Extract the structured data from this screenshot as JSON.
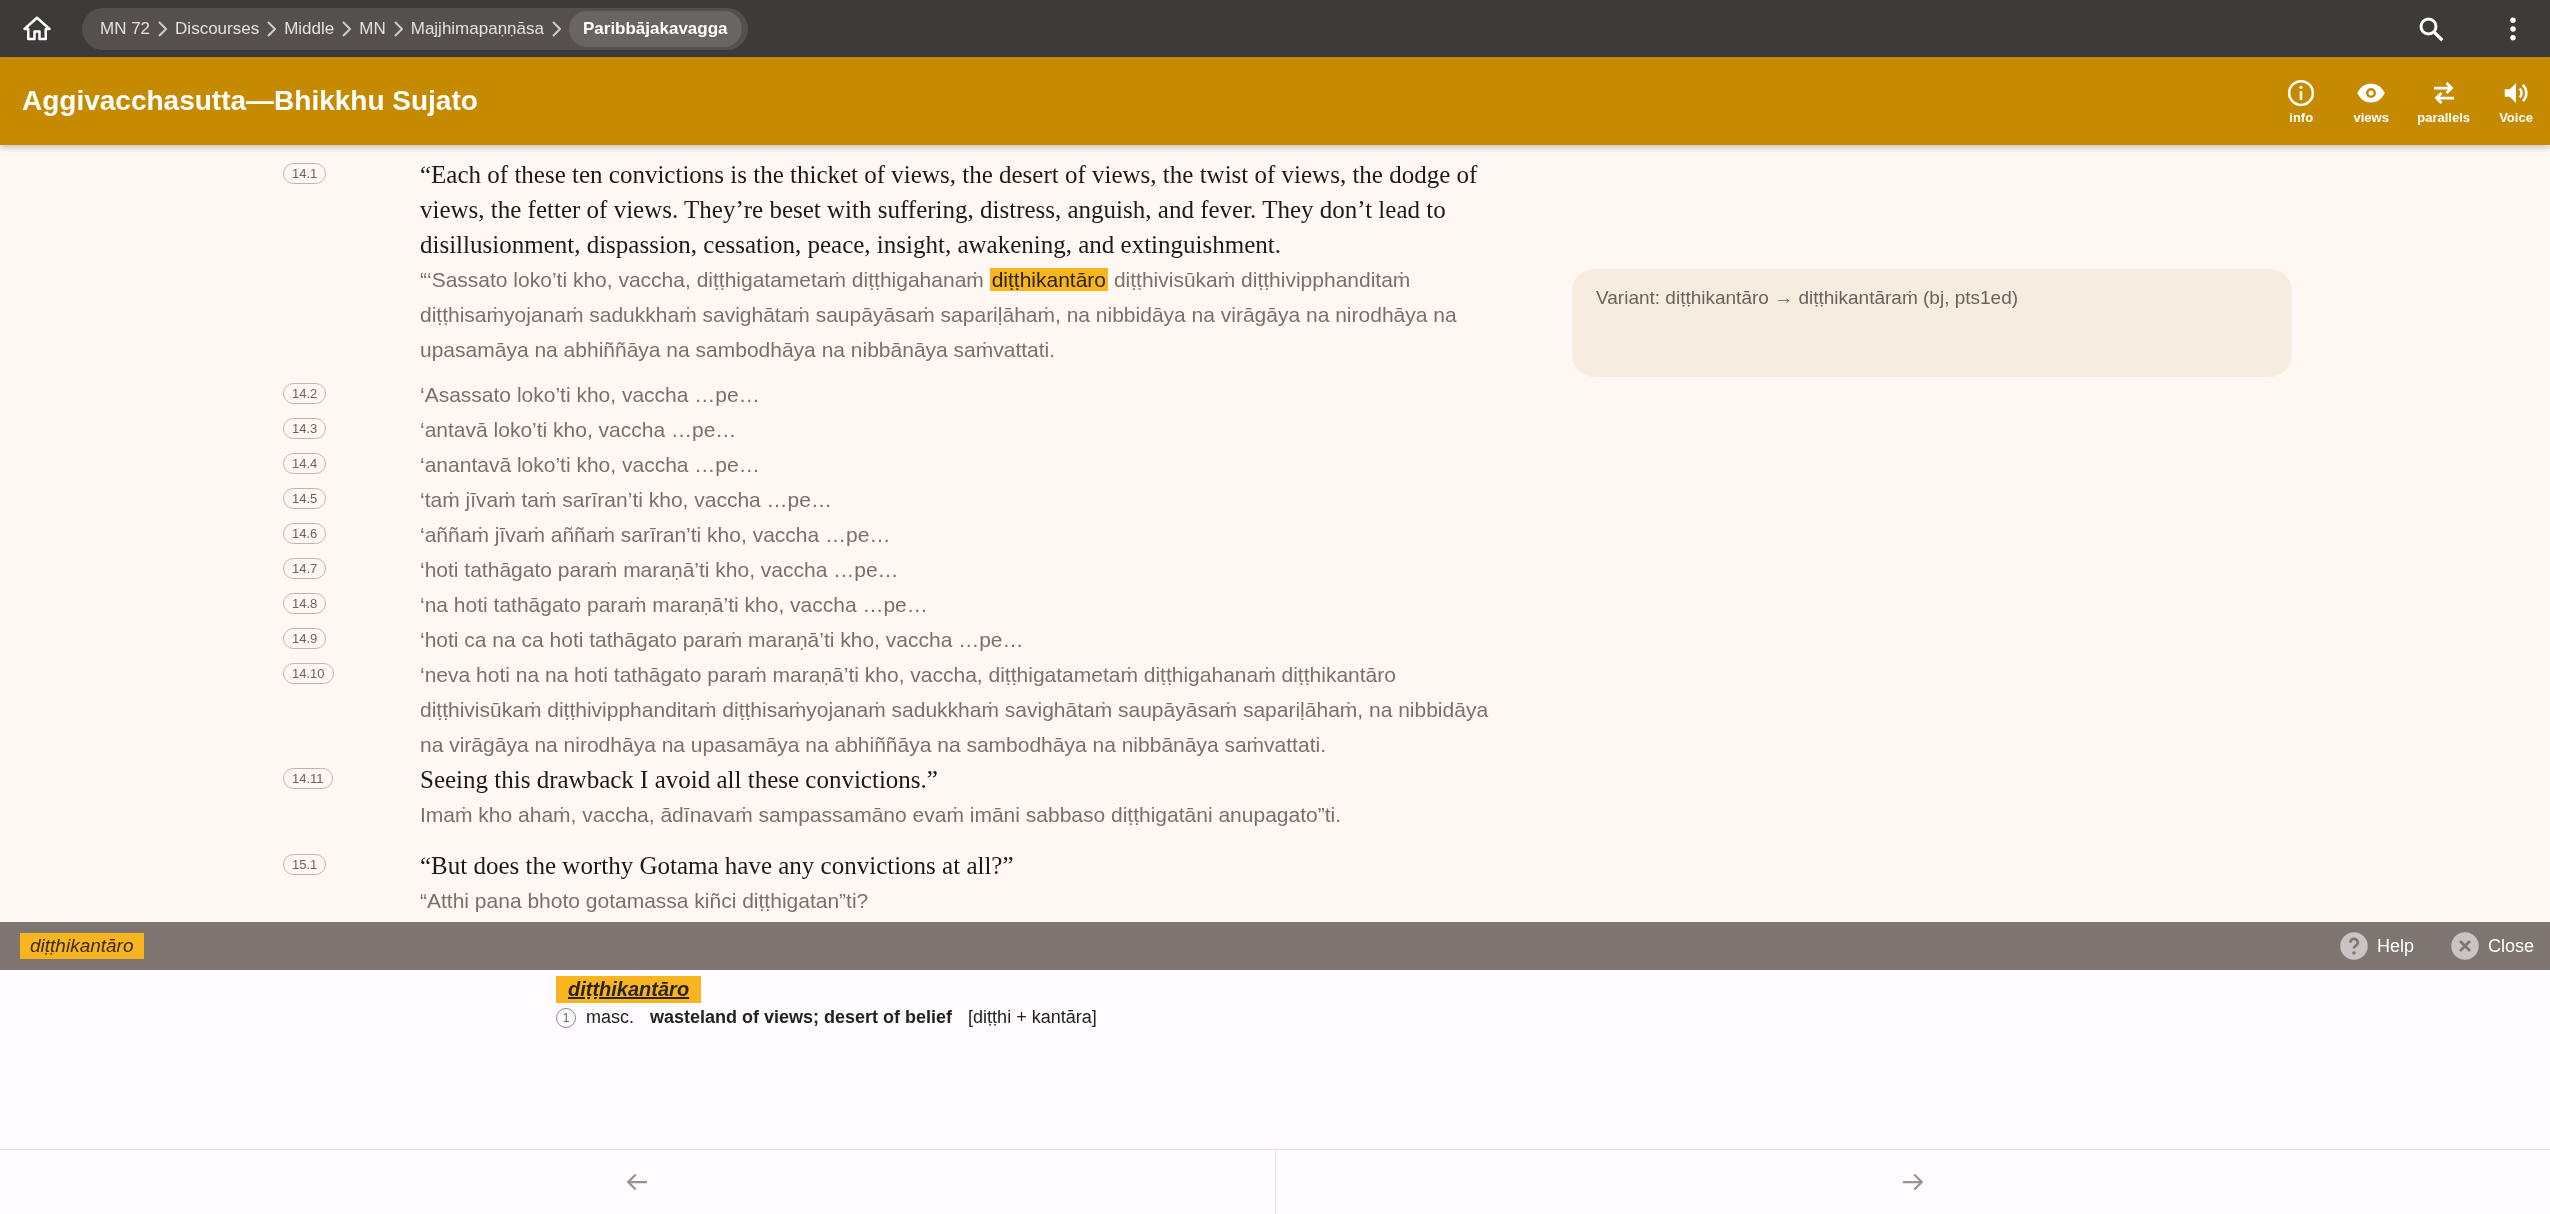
{
  "breadcrumb": [
    {
      "label": "MN 72",
      "current": false
    },
    {
      "label": "Discourses",
      "current": false
    },
    {
      "label": "Middle",
      "current": false
    },
    {
      "label": "MN",
      "current": false
    },
    {
      "label": "Majjhimapaṇṇāsa",
      "current": false
    },
    {
      "label": "Paribbājakavagga",
      "current": true
    }
  ],
  "title": "Aggivacchasutta—Bhikkhu Sujato",
  "actions": [
    {
      "kind": "info",
      "label": "info"
    },
    {
      "kind": "views",
      "label": "views"
    },
    {
      "kind": "parallels",
      "label": "parallels"
    },
    {
      "kind": "voice",
      "label": "Voice"
    }
  ],
  "paragraphs": [
    {
      "segments": [
        {
          "id": "14.1",
          "english": "“Each of these ten convictions is the thicket of views, the desert of views, the twist of views, the dodge of views, the fetter of views. They’re beset with suffering, distress, anguish, and fever. They don’t lead to disillusionment, dispassion, cessation, peace, insight, awakening, and extinguishment.",
          "pali": [
            {
              "text": "“‘Sassato loko’ti kho, vaccha, diṭṭhigatametaṁ diṭṭhigahanaṁ ",
              "highlighted": false
            },
            {
              "text": "diṭṭhikantāro",
              "highlighted": true
            },
            {
              "text": " diṭṭhivisūkaṁ diṭṭhivipphanditaṁ diṭṭhisaṁyojanaṁ sadukkhaṁ savighātaṁ saupāyāsaṁ sapariḷāhaṁ, na nibbidāya na virāgāya na nirodhāya na upasamāya na abhiññāya na sambodhāya na nibbānāya saṁvattati.",
              "highlighted": false
            }
          ],
          "note": "Variant: diṭṭhikantāro → diṭṭhikantāraṁ (bj, pts1ed)"
        },
        {
          "id": "14.2",
          "pali": [
            {
              "text": "‘Asassato loko’ti kho, vaccha …pe…",
              "highlighted": false
            }
          ]
        },
        {
          "id": "14.3",
          "pali": [
            {
              "text": "‘antavā loko’ti kho, vaccha …pe…",
              "highlighted": false
            }
          ]
        },
        {
          "id": "14.4",
          "pali": [
            {
              "text": "‘anantavā loko’ti kho, vaccha …pe…",
              "highlighted": false
            }
          ]
        },
        {
          "id": "14.5",
          "pali": [
            {
              "text": "‘taṁ jīvaṁ taṁ sarīran’ti kho, vaccha …pe…",
              "highlighted": false
            }
          ]
        },
        {
          "id": "14.6",
          "pali": [
            {
              "text": "‘aññaṁ jīvaṁ aññaṁ sarīran’ti kho, vaccha …pe…",
              "highlighted": false
            }
          ]
        },
        {
          "id": "14.7",
          "pali": [
            {
              "text": "‘hoti tathāgato paraṁ maraṇā’ti kho, vaccha …pe…",
              "highlighted": false
            }
          ]
        },
        {
          "id": "14.8",
          "pali": [
            {
              "text": "‘na hoti tathāgato paraṁ maraṇā’ti kho, vaccha …pe…",
              "highlighted": false
            }
          ]
        },
        {
          "id": "14.9",
          "pali": [
            {
              "text": "‘hoti ca na ca hoti tathāgato paraṁ maraṇā’ti kho, vaccha …pe…",
              "highlighted": false
            }
          ]
        },
        {
          "id": "14.10",
          "pali": [
            {
              "text": "‘neva hoti na na hoti tathāgato paraṁ maraṇā’ti kho, vaccha, diṭṭhigatametaṁ diṭṭhigahanaṁ diṭṭhikantāro diṭṭhivisūkaṁ diṭṭhivipphanditaṁ diṭṭhisaṁyojanaṁ sadukkhaṁ savighātaṁ saupāyāsaṁ sapariḷāhaṁ, na nibbidāya na virāgāya na nirodhāya na upasamāya na abhiññāya na sambodhāya na nibbānāya saṁvattati.",
              "highlighted": false
            }
          ]
        },
        {
          "id": "14.11",
          "english": "Seeing this drawback I avoid all these convictions.”",
          "pali": [
            {
              "text": "Imaṁ kho ahaṁ, vaccha, ādīnavaṁ sampassamāno evaṁ imāni sabbaso diṭṭhigatāni anupagato”ti.",
              "highlighted": false
            }
          ]
        }
      ]
    },
    {
      "segments": [
        {
          "id": "15.1",
          "english": "“But does the worthy Gotama have any convictions at all?”",
          "pali": [
            {
              "text": "“Atthi pana bhoto gotamassa kiñci diṭṭhigatan”ti?",
              "highlighted": false
            }
          ]
        }
      ]
    }
  ],
  "lookup": {
    "word": "diṭṭhikantāro",
    "help": "Help",
    "close": "Close",
    "headword": "diṭṭhikantāro",
    "senses": [
      {
        "number": "1",
        "grammar": "masc.",
        "meaning": "wasteland of views; desert of belief",
        "construction": "[diṭṭhi + kantāra]"
      }
    ]
  }
}
